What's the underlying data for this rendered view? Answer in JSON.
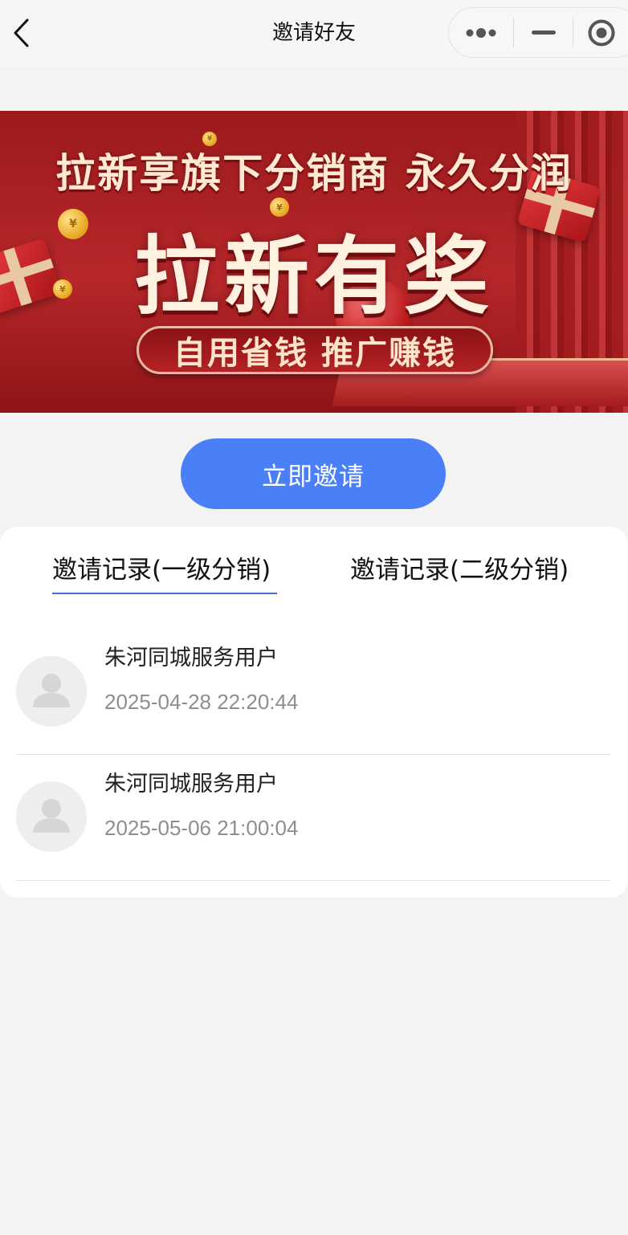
{
  "navbar": {
    "title": "邀请好友",
    "back_icon": "chevron-left-icon",
    "more_icon": "more-dots-icon",
    "minimize_icon": "minus-icon",
    "close_icon": "target-circle-icon"
  },
  "banner": {
    "headline": "拉新享旗下分销商 永久分润",
    "main_title": "拉新有奖",
    "slogan": "自用省钱 推广赚钱",
    "coin_symbol": "¥"
  },
  "invite_button": {
    "label": "立即邀请",
    "color": "#4a80f7"
  },
  "tabs": [
    {
      "label": "邀请记录(一级分销)",
      "active": true
    },
    {
      "label": "邀请记录(二级分销)",
      "active": false
    }
  ],
  "records": [
    {
      "name": "朱河同城服务用户",
      "time": "2025-04-28 22:20:44",
      "avatar_icon": "user-silhouette-icon"
    },
    {
      "name": "朱河同城服务用户",
      "time": "2025-05-06 21:00:04",
      "avatar_icon": "user-silhouette-icon"
    }
  ],
  "colors": {
    "accent": "#4a80f7",
    "tab_underline": "#3e70d8",
    "banner_red": "#b7272a"
  }
}
